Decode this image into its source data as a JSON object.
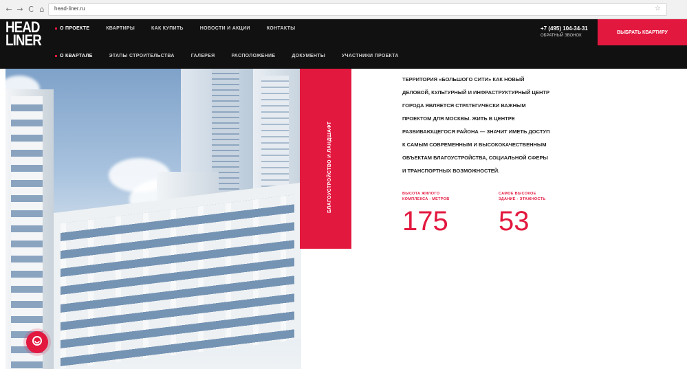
{
  "browser": {
    "url": "head-liner.ru",
    "nav": [
      "←",
      "→",
      "C",
      "⌂"
    ],
    "star": "☆"
  },
  "header": {
    "logo_lines": [
      "HEAD",
      "LINER"
    ],
    "top_nav": [
      "О ПРОЕКТЕ",
      "КВАРТИРЫ",
      "КАК КУПИТЬ",
      "НОВОСТИ И АКЦИИ",
      "КОНТАКТЫ"
    ],
    "sub_nav": [
      "О КВАРТАЛЕ",
      "ЭТАПЫ СТРОИТЕЛЬСТВА",
      "ГАЛЕРЕЯ",
      "РАСПОЛОЖЕНИЕ",
      "ДОКУМЕНТЫ",
      "УЧАСТНИКИ ПРОЕКТА"
    ],
    "phone": "+7 (495) 104-34-31",
    "callback": "ОБРАТНЫЙ ЗВОНОК",
    "cta": "ВЫБРАТЬ КВАРТИРУ"
  },
  "main": {
    "vertical_label": "БЛАГОУСТРОЙСТВО И ЛАНДШАФТ",
    "paragraph_lines": [
      "ТЕРРИТОРИЯ «БОЛЬШОГО СИТИ» КАК НОВЫЙ",
      "ДЕЛОВОЙ, КУЛЬТУРНЫЙ И ИНФРАСТРУКТУРНЫЙ ЦЕНТР",
      "ГОРОДА ЯВЛЯЕТСЯ СТРАТЕГИЧЕСКИ ВАЖНЫМ",
      "ПРОЕКТОМ ДЛЯ МОСКВЫ. ЖИТЬ В ЦЕНТРЕ",
      "РАЗВИВАЮЩЕГОСЯ РАЙОНА — ЗНАЧИТ ИМЕТЬ ДОСТУП",
      "К САМЫМ СОВРЕМЕННЫМ И ВЫСОКОКАЧЕСТВЕННЫМ",
      "ОБЪЕКТАМ БЛАГОУСТРОЙСТВА, СОЦИАЛЬНОЙ СФЕРЫ",
      "И ТРАНСПОРТНЫХ ВОЗМОЖНОСТЕЙ."
    ],
    "stats": [
      {
        "label_lines": [
          "ВЫСОТА ЖИЛОГО",
          "КОМПЛЕКСА - МЕТРОВ"
        ],
        "value": "175"
      },
      {
        "label_lines": [
          "САМОЕ ВЫСОКОЕ",
          "ЗДАНИЕ - ЭТАЖНОСТЬ"
        ],
        "value": "53"
      }
    ]
  },
  "colors": {
    "accent": "#e3183f",
    "header_bg": "#111111"
  },
  "icons": {
    "chat": "chat-icon"
  }
}
